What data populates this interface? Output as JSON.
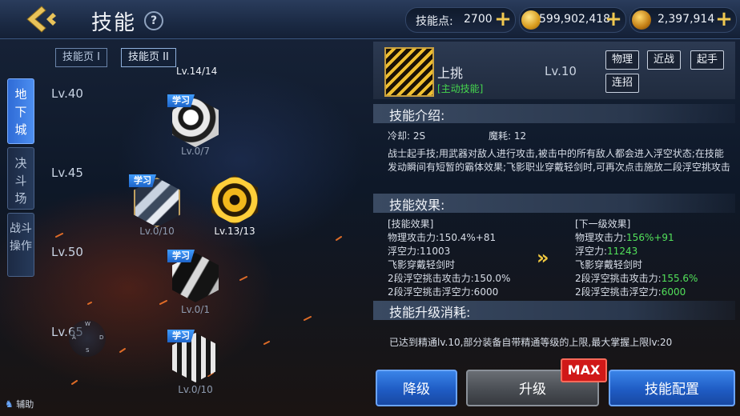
{
  "header": {
    "title": "技能",
    "skill_points_label": "技能点:",
    "skill_points_value": "2700",
    "gold": "599,902,418",
    "cash": "2,397,914"
  },
  "side_tabs": [
    "地下城",
    "决斗场",
    "战斗操作"
  ],
  "page_tabs": [
    "技能页 I",
    "技能页 II"
  ],
  "tree": {
    "top_counter": "Lv.14/14",
    "levels": [
      "Lv.40",
      "Lv.45",
      "Lv.50",
      "Lv.65"
    ],
    "learn_badge": "学习",
    "skills": [
      {
        "level": "Lv.0/7"
      },
      {
        "level": "Lv.0/10"
      },
      {
        "level": "Lv.13/13"
      },
      {
        "level": "Lv.0/1"
      },
      {
        "level": "Lv.0/10"
      }
    ],
    "compass": {
      "n": "W",
      "w": "A",
      "e": "D",
      "s": "S"
    }
  },
  "detail": {
    "name": "上挑",
    "type": "[主动技能]",
    "level": "Lv.10",
    "tags": [
      "物理",
      "近战",
      "起手",
      "连招"
    ],
    "intro_title": "技能介绍:",
    "cooldown": "冷却: 2S",
    "mana": "魔耗: 12",
    "description": "战士起手技;用武器对敌人进行攻击,被击中的所有敌人都会进入浮空状态;在技能发动瞬间有短暂的霸体效果;飞影职业穿戴轻剑时,可再次点击施放二段浮空挑攻击",
    "effect_title": "技能效果:",
    "current_header": "[技能效果]",
    "current": [
      "物理攻击力:150.4%+81",
      "浮空力:11003",
      "飞影穿戴轻剑时",
      "2段浮空挑击攻击力:150.0%",
      "2段浮空挑击浮空力:6000"
    ],
    "next_header": "[下一级效果]",
    "next": [
      {
        "label": "物理攻击力:",
        "value": "156%+91"
      },
      {
        "label": "浮空力:",
        "value": "11243"
      },
      {
        "label": "飞影穿戴轻剑时",
        "value": ""
      },
      {
        "label": "2段浮空挑击攻击力:",
        "value": "155.6%"
      },
      {
        "label": "2段浮空挑击浮空力:",
        "value": "6000"
      }
    ],
    "upgrade_title": "技能升级消耗:",
    "upgrade_text": "已达到精通lv.10,部分装备自带精通等级的上限,最大掌握上限lv:20"
  },
  "buttons": {
    "downgrade": "降级",
    "upgrade": "升级",
    "max_badge": "MAX",
    "config": "技能配置"
  },
  "assist": "辅助"
}
